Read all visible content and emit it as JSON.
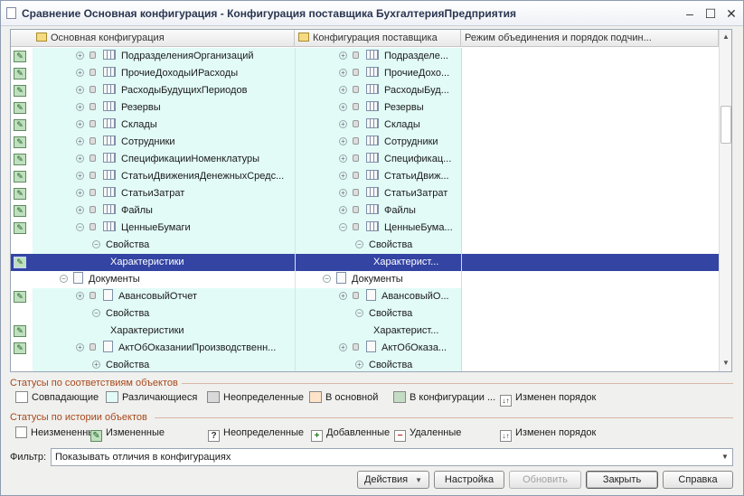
{
  "window": {
    "title": "Сравнение Основная конфигурация - Конфигурация поставщика БухгалтерияПредприятия",
    "minimize": "–",
    "maximize": "☐",
    "close": "✕"
  },
  "tree": {
    "columns": [
      "Основная конфигурация",
      "Конфигурация поставщика",
      "Режим объединения и порядок подчин..."
    ],
    "rows": [
      {
        "status": true,
        "indent": 2,
        "exp": "+",
        "lock": true,
        "icon": "register",
        "main": "ПодразделенияОрганизаций",
        "supplier": "Подразделе...",
        "mode": ""
      },
      {
        "status": true,
        "indent": 2,
        "exp": "+",
        "lock": true,
        "icon": "register",
        "main": "ПрочиеДоходыИРасходы",
        "supplier": "ПрочиеДохо...",
        "mode": ""
      },
      {
        "status": true,
        "indent": 2,
        "exp": "+",
        "lock": true,
        "icon": "register",
        "main": "РасходыБудущихПериодов",
        "supplier": "РасходыБуд...",
        "mode": ""
      },
      {
        "status": true,
        "indent": 2,
        "exp": "+",
        "lock": true,
        "icon": "register",
        "main": "Резервы",
        "supplier": "Резервы",
        "mode": ""
      },
      {
        "status": true,
        "indent": 2,
        "exp": "+",
        "lock": true,
        "icon": "register",
        "main": "Склады",
        "supplier": "Склады",
        "mode": ""
      },
      {
        "status": true,
        "indent": 2,
        "exp": "+",
        "lock": true,
        "icon": "register",
        "main": "Сотрудники",
        "supplier": "Сотрудники",
        "mode": ""
      },
      {
        "status": true,
        "indent": 2,
        "exp": "+",
        "lock": true,
        "icon": "register",
        "main": "СпецификацииНоменклатуры",
        "supplier": "Спецификац...",
        "mode": ""
      },
      {
        "status": true,
        "indent": 2,
        "exp": "+",
        "lock": true,
        "icon": "register",
        "main": "СтатьиДвиженияДенежныхСредс...",
        "supplier": "СтатьиДвиж...",
        "mode": ""
      },
      {
        "status": true,
        "indent": 2,
        "exp": "+",
        "lock": true,
        "icon": "register",
        "main": "СтатьиЗатрат",
        "supplier": "СтатьиЗатрат",
        "mode": ""
      },
      {
        "status": true,
        "indent": 2,
        "exp": "+",
        "lock": true,
        "icon": "register",
        "main": "Файлы",
        "supplier": "Файлы",
        "mode": ""
      },
      {
        "status": true,
        "indent": 2,
        "exp": "−",
        "lock": true,
        "icon": "register",
        "main": "ЦенныеБумаги",
        "supplier": "ЦенныеБума...",
        "mode": ""
      },
      {
        "status": false,
        "indent": 3,
        "exp": "−",
        "lock": false,
        "icon": "",
        "main": "Свойства",
        "supplier": "Свойства",
        "mode": ""
      },
      {
        "status": true,
        "indent": 4,
        "exp": "",
        "lock": false,
        "icon": "",
        "main": "Характеристики",
        "supplier": "Характерист...",
        "mode": "",
        "selected": true
      },
      {
        "status": false,
        "indent": 1,
        "exp": "−",
        "lock": false,
        "icon": "doc",
        "main": "Документы",
        "supplier": "Документы",
        "mode": "",
        "plain": true
      },
      {
        "status": true,
        "indent": 2,
        "exp": "+",
        "lock": true,
        "icon": "doc",
        "main": "АвансовыйОтчет",
        "supplier": "АвансовыйО...",
        "mode": ""
      },
      {
        "status": false,
        "indent": 3,
        "exp": "−",
        "lock": false,
        "icon": "",
        "main": "Свойства",
        "supplier": "Свойства",
        "mode": ""
      },
      {
        "status": true,
        "indent": 4,
        "exp": "",
        "lock": false,
        "icon": "",
        "main": "Характеристики",
        "supplier": "Характерист...",
        "mode": ""
      },
      {
        "status": true,
        "indent": 2,
        "exp": "+",
        "lock": true,
        "icon": "doc",
        "main": "АктОбОказанииПроизводственн...",
        "supplier": "АктОбОказа...",
        "mode": ""
      },
      {
        "status": false,
        "indent": 3,
        "exp": "+",
        "lock": false,
        "icon": "",
        "main": "Свойства",
        "supplier": "Свойства",
        "mode": ""
      }
    ]
  },
  "legend_match": {
    "title": "Статусы по соответствиям объектов",
    "items": [
      {
        "label": "Совпадающие",
        "color": "#ffffff"
      },
      {
        "label": "Различающиеся",
        "color": "#e2fbf7"
      },
      {
        "label": "Неопределенные",
        "color": "#d9d9d9"
      },
      {
        "label": "В основной",
        "color": "#fde3c8"
      },
      {
        "label": "В конфигурации ...",
        "color": "#c4dcc4"
      },
      {
        "label": "Изменен порядок",
        "icon": "↓↑"
      }
    ]
  },
  "legend_history": {
    "title": "Статусы по истории объектов",
    "items": [
      {
        "label": "Неизмененные",
        "icon": ""
      },
      {
        "label": "Измененные",
        "icon": "✎"
      },
      {
        "label": "Неопределенные",
        "icon": "?"
      },
      {
        "label": "Добавленные",
        "icon": "+"
      },
      {
        "label": "Удаленные",
        "icon": "−"
      },
      {
        "label": "Изменен порядок",
        "icon": "↓↑"
      }
    ]
  },
  "filter": {
    "label": "Фильтр:",
    "value": "Показывать отличия в конфигурациях"
  },
  "buttons": {
    "actions": "Действия",
    "settings": "Настройка",
    "refresh": "Обновить",
    "close": "Закрыть",
    "help": "Справка"
  },
  "colors": {
    "differs": "#e2fbf7",
    "selection": "#3344a3",
    "section_title": "#a8481a"
  }
}
